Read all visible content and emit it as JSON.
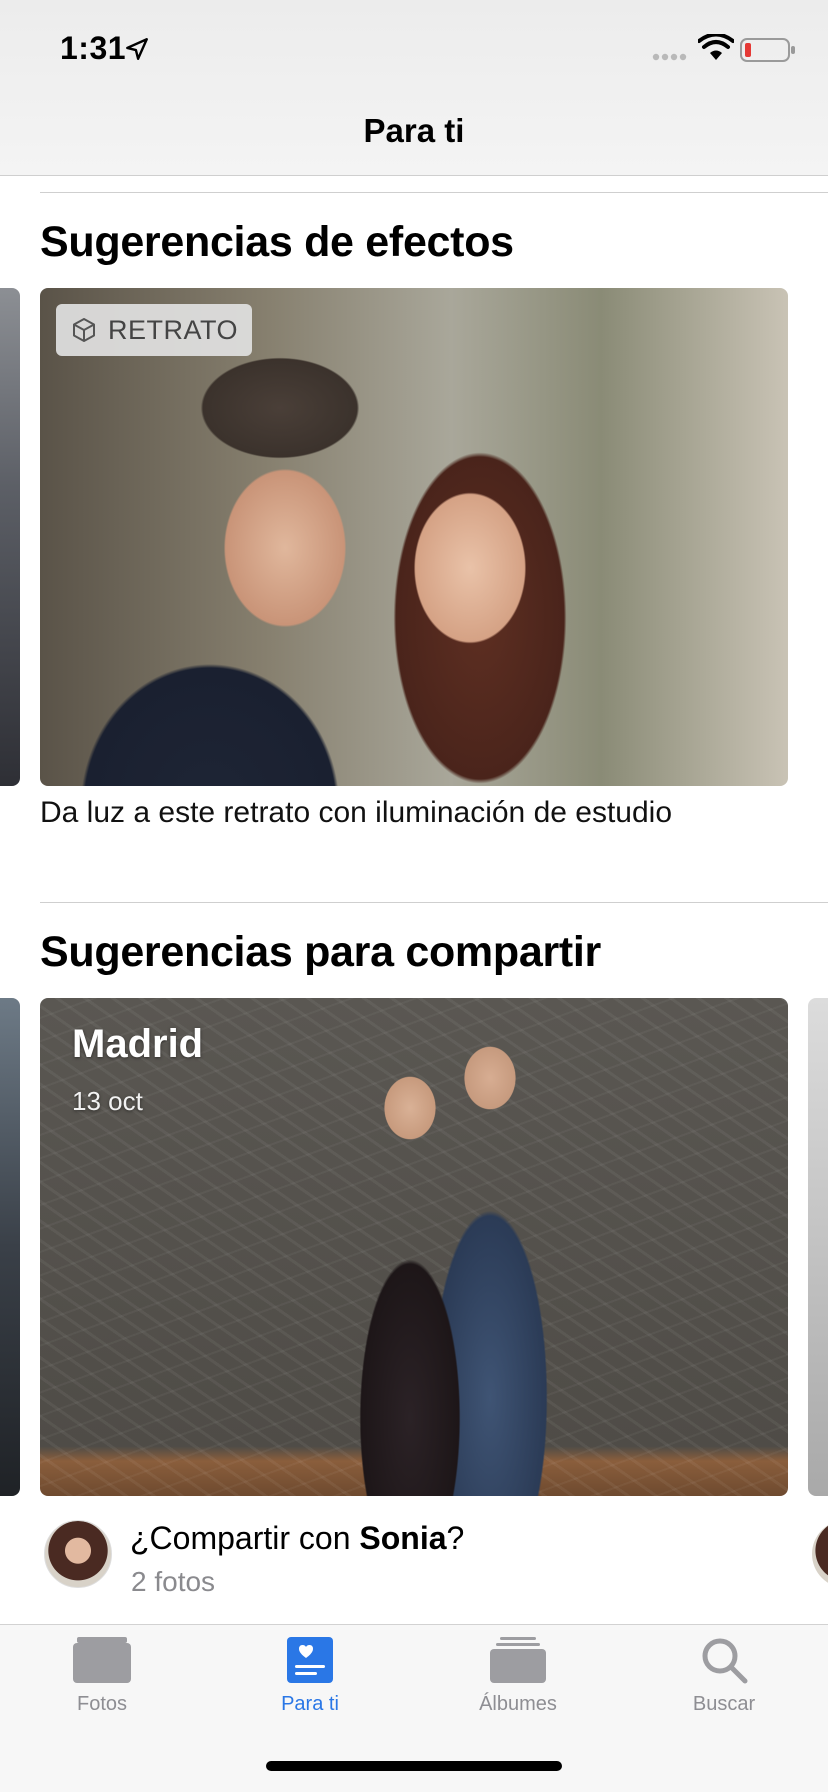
{
  "status_bar": {
    "time": "1:31"
  },
  "header": {
    "title": "Para ti"
  },
  "effects_section": {
    "title": "Sugerencias de efectos",
    "badge_label": "RETRATO",
    "caption": "Da luz a este retrato con iluminación de estudio"
  },
  "share_section": {
    "title": "Sugerencias para compartir",
    "photo_place": "Madrid",
    "photo_date": "13 oct",
    "question_prefix": "¿Compartir con ",
    "contact_name": "Sonia",
    "question_suffix": "?",
    "photo_count": "2 fotos"
  },
  "tab_bar": {
    "tabs": [
      {
        "label": "Fotos",
        "icon": "photos-icon",
        "active": false
      },
      {
        "label": "Para ti",
        "icon": "for-you-icon",
        "active": true
      },
      {
        "label": "Álbumes",
        "icon": "albums-icon",
        "active": false
      },
      {
        "label": "Buscar",
        "icon": "search-icon",
        "active": false
      }
    ]
  },
  "colors": {
    "accent": "#2a77e6",
    "inactive": "#8e8e93",
    "battery_low": "#e53935"
  }
}
